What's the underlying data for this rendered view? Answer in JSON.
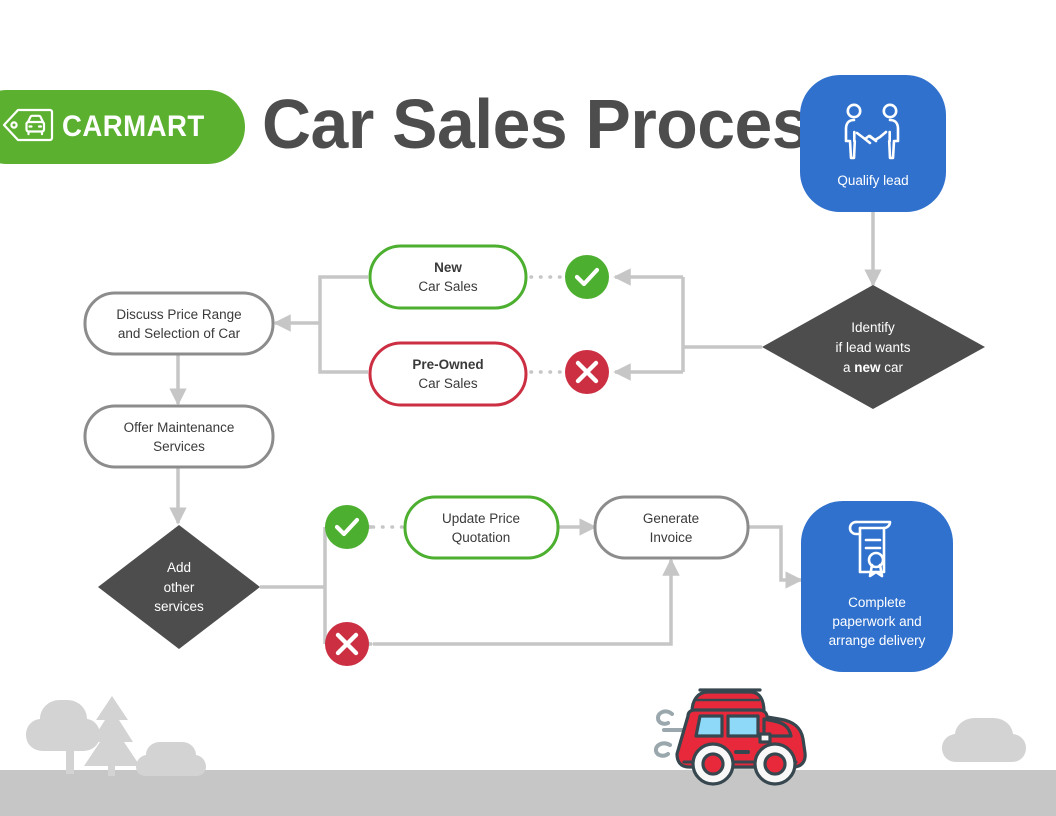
{
  "header": {
    "brand": "CARMART",
    "brand_icon": "car-tag-icon",
    "title": "Car Sales Process"
  },
  "colors": {
    "brand_green": "#5CB030",
    "accent_blue": "#3071CE",
    "success_green": "#4CAF2F",
    "error_red": "#CC2E42",
    "dark_gray": "#4D4D4D",
    "line_gray": "#C6C6C6",
    "node_outline": "#8C8C8C",
    "title_gray": "#4D4D4D"
  },
  "flow": {
    "qualify_lead": {
      "label": "Qualify lead",
      "icon": "handshake-icon",
      "type": "terminal",
      "color": "#3071CE"
    },
    "decision_new_car": {
      "type": "decision",
      "line1": "Identify",
      "line2": "if lead wants",
      "line3_prefix": "a ",
      "line3_bold": "new",
      "line3_suffix": " car"
    },
    "new_car_sales": {
      "type": "process",
      "line1": "New",
      "line2": "Car Sales",
      "outline": "#4CAF2F",
      "branch": "yes"
    },
    "preowned_car_sales": {
      "type": "process",
      "line1": "Pre-Owned",
      "line2": "Car Sales",
      "outline": "#CC2E42",
      "branch": "no"
    },
    "discuss_price": {
      "type": "process",
      "line1": "Discuss Price Range",
      "line2": "and Selection of Car",
      "outline": "#8C8C8C"
    },
    "offer_maintenance": {
      "type": "process",
      "line1": "Offer Maintenance",
      "line2": "Services",
      "outline": "#8C8C8C"
    },
    "decision_add_services": {
      "type": "decision",
      "line1": "Add",
      "line2": "other",
      "line3": "services"
    },
    "update_quotation": {
      "type": "process",
      "line1": "Update Price",
      "line2": "Quotation",
      "outline": "#4CAF2F",
      "branch": "yes"
    },
    "generate_invoice": {
      "type": "process",
      "line1": "Generate",
      "line2": "Invoice",
      "outline": "#8C8C8C"
    },
    "complete_paperwork": {
      "type": "terminal",
      "line1": "Complete",
      "line2": "paperwork and",
      "line3": "arrange delivery",
      "icon": "certificate-icon",
      "color": "#3071CE"
    },
    "badges": {
      "yes_icon": "check-circle-icon",
      "no_icon": "x-circle-icon"
    }
  },
  "decoration": {
    "car": "red-suv-illustration",
    "left_trees": "tree-silhouettes",
    "right_bush": "bush-silhouette",
    "ground": "ground-strip"
  }
}
